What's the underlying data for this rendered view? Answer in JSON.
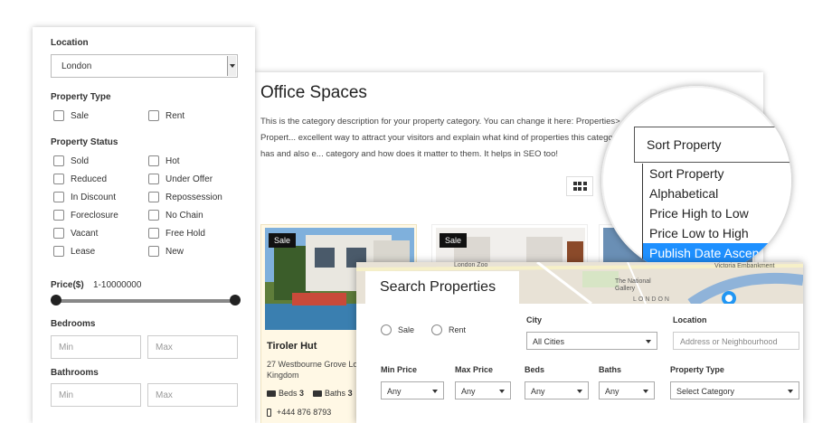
{
  "listing": {
    "title": "Office Spaces",
    "description": "This is the category description for your property category. You can change it here: Properties> Propert... excellent way to attract your visitors and explain what kind of properties this category has and also e... category and how does it matter to them. It helps in SEO too!",
    "view_icon": "grid-icon",
    "cards": [
      {
        "badge": "Sale",
        "name": "Tiroler Hut",
        "address": "27 Westbourne Grove Lo... United Kingdom",
        "beds_label": "Beds",
        "beds": "3",
        "baths_label": "Baths",
        "baths": "3",
        "phone": "+444 876 8793"
      },
      {
        "badge": "Sale"
      },
      {
        "badge": ""
      }
    ]
  },
  "sort": {
    "selected": "Sort Property",
    "options": [
      "Sort Property",
      "Alphabetical",
      "Price High to Low",
      "Price Low to High",
      "Publish Date Ascend"
    ],
    "active_index": 4
  },
  "filters": {
    "location_label": "Location",
    "location_value": "London",
    "type_label": "Property Type",
    "types": [
      "Sale",
      "Rent"
    ],
    "status_label": "Property Status",
    "statuses": [
      "Sold",
      "Hot",
      "Reduced",
      "Under Offer",
      "In Discount",
      "Repossession",
      "Foreclosure",
      "No Chain",
      "Vacant",
      "Free Hold",
      "Lease",
      "New"
    ],
    "price_label": "Price($)",
    "price_range": "1-10000000",
    "price_min_fraction": 0,
    "price_max_fraction": 1,
    "bedrooms_label": "Bedrooms",
    "bathrooms_label": "Bathrooms",
    "min_placeholder": "Min",
    "max_placeholder": "Max"
  },
  "search": {
    "title": "Search Properties",
    "map_labels": [
      "London Zoo",
      "The National Gallery",
      "LONDON",
      "Victoria Embankment"
    ],
    "sale_label": "Sale",
    "rent_label": "Rent",
    "city_label": "City",
    "city_value": "All Cities",
    "location_label": "Location",
    "location_placeholder": "Address or Neighbourhood",
    "min_price_label": "Min Price",
    "max_price_label": "Max Price",
    "beds_label": "Beds",
    "baths_label": "Baths",
    "type_label": "Property Type",
    "any": "Any",
    "category_value": "Select Category"
  },
  "colors": {
    "highlight": "#1e90ff",
    "card_bg": "#fff8e5",
    "map": "#e8e2d6"
  }
}
